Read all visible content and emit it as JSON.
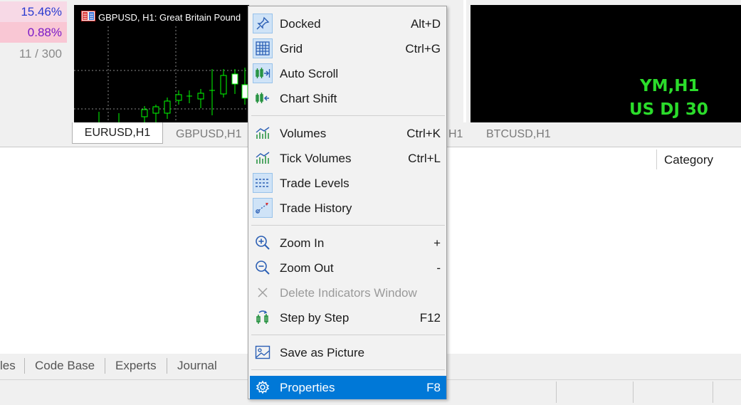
{
  "market_watch": {
    "row1_value": "15.46%",
    "row2_value": "0.88%",
    "row3_value": "11 / 300"
  },
  "chart_left": {
    "title": "GBPUSD, H1:  Great Britain Pound"
  },
  "chart_right": {
    "symbol": "YM,H1",
    "description": "US DJ 30"
  },
  "chart_tabs": {
    "eurusd": "EURUSD,H1",
    "gbpusd": "GBPUSD,H1",
    "partial": "H1",
    "btcusd": "BTCUSD,H1"
  },
  "toolbox": {
    "category_header": "Category"
  },
  "bottom_tabs": {
    "partial": "les",
    "code_base": "Code Base",
    "experts": "Experts",
    "journal": "Journal"
  },
  "context_menu": {
    "items": [
      {
        "label": "Docked",
        "shortcut": "Alt+D",
        "icon": "pin-icon"
      },
      {
        "label": "Grid",
        "shortcut": "Ctrl+G",
        "icon": "grid-icon"
      },
      {
        "label": "Auto Scroll",
        "shortcut": "",
        "icon": "auto-scroll-icon"
      },
      {
        "label": "Chart Shift",
        "shortcut": "",
        "icon": "chart-shift-icon"
      },
      {
        "label": "Volumes",
        "shortcut": "Ctrl+K",
        "icon": "volumes-icon"
      },
      {
        "label": "Tick Volumes",
        "shortcut": "Ctrl+L",
        "icon": "tick-volumes-icon"
      },
      {
        "label": "Trade Levels",
        "shortcut": "",
        "icon": "trade-levels-icon"
      },
      {
        "label": "Trade History",
        "shortcut": "",
        "icon": "trade-history-icon"
      },
      {
        "label": "Zoom In",
        "shortcut": "+",
        "icon": "zoom-in-icon"
      },
      {
        "label": "Zoom Out",
        "shortcut": "-",
        "icon": "zoom-out-icon"
      },
      {
        "label": "Delete Indicators Window",
        "shortcut": "",
        "icon": "close-icon"
      },
      {
        "label": "Step by Step",
        "shortcut": "F12",
        "icon": "step-icon"
      },
      {
        "label": "Save as Picture",
        "shortcut": "",
        "icon": "picture-icon"
      },
      {
        "label": "Properties",
        "shortcut": "F8",
        "icon": "gear-icon"
      }
    ]
  },
  "colors": {
    "menu_highlight": "#0078d7",
    "chart_text": "#2bdc2b",
    "candle": "#00ff00"
  }
}
